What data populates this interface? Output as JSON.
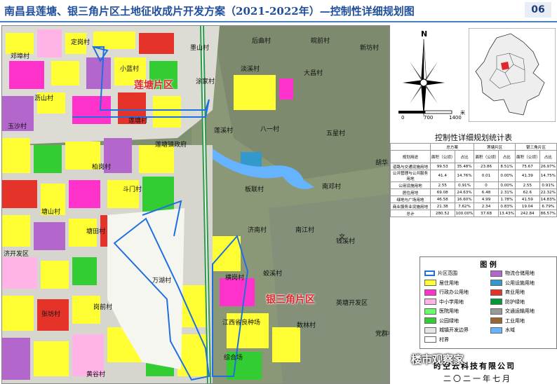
{
  "title": "南昌县莲塘、银三角片区土地征收成片开发方案（2021-2022年）—控制性详细规划图",
  "page_number": "06",
  "map": {
    "zones": [
      "莲塘片区",
      "银三角片区"
    ],
    "places": [
      "定岗村",
      "邓埠村",
      "小蓝村",
      "沥山村",
      "莲塘村",
      "玉沙村",
      "后曲村",
      "皖前村",
      "新坊村",
      "墨山村",
      "淡溪村",
      "涂家村",
      "大昌村",
      "莲溪村",
      "八一村",
      "五星村",
      "胡华",
      "莲塘镇政府",
      "柏岗村",
      "斗门村",
      "板联村",
      "南邓村",
      "塘山村",
      "塘田村",
      "济南村",
      "南江村",
      "钱溪村",
      "济开发区",
      "万湖村",
      "横岗村",
      "蛟溪村",
      "岗前村",
      "张坊村",
      "英塘开发区",
      "江西省良种场",
      "数林村",
      "党群村",
      "综合场",
      "黄谷村",
      "文"
    ]
  },
  "scale": {
    "north": "N",
    "labels": [
      "0",
      "700",
      "1400",
      "米"
    ]
  },
  "stats": {
    "title": "控制性详细规划统计表",
    "group_headers": [
      "总方案",
      "莲塘片区",
      "银三角片区"
    ],
    "col_headers": [
      "规划用途",
      "面积（公顷）",
      "占比",
      "面积（公顷）",
      "占比",
      "面积（公顷）",
      "占比"
    ],
    "rows": [
      [
        "道路与交通设施用地",
        "99.53",
        "35.48%",
        "23.86",
        "8.51%",
        "75.67",
        "26.97%"
      ],
      [
        "公共管理与公共服务用地",
        "41.4",
        "14.76%",
        "0.01",
        "0.00%",
        "41.39",
        "14.75%"
      ],
      [
        "公用设施用地",
        "2.55",
        "0.91%",
        "0",
        "0.00%",
        "2.55",
        "0.91%"
      ],
      [
        "居住用地",
        "69.08",
        "24.63%",
        "6.48",
        "2.31%",
        "62.6",
        "22.32%"
      ],
      [
        "绿地与广场用地",
        "46.58",
        "16.60%",
        "4.99",
        "1.78%",
        "41.59",
        "14.83%"
      ],
      [
        "商业服务业设施用地",
        "21.38",
        "7.62%",
        "2.34",
        "0.83%",
        "19.04",
        "6.79%"
      ],
      [
        "总计",
        "280.52",
        "100.00%",
        "37.68",
        "13.43%",
        "242.84",
        "86.57%"
      ]
    ]
  },
  "legend": {
    "title": "图 例",
    "items": [
      {
        "label": "片区范围",
        "color": "#1f6fe0"
      },
      {
        "label": "居住用地",
        "color": "#ffff33"
      },
      {
        "label": "行政办公用地",
        "color": "#ff33cc"
      },
      {
        "label": "中小学用地",
        "color": "#ffb3e6"
      },
      {
        "label": "医院用地",
        "color": "#66ff66"
      },
      {
        "label": "公园绿地",
        "color": "#33cc33"
      },
      {
        "label": "城镇开发边界",
        "color": "#e6e6e6"
      },
      {
        "label": "村界",
        "color": "#ffffff"
      },
      {
        "label": "物流仓储用地",
        "color": "#b366cc"
      },
      {
        "label": "公用设施用地",
        "color": "#3399cc"
      },
      {
        "label": "商业用地",
        "color": "#e6332a"
      },
      {
        "label": "防护绿地",
        "color": "#009933"
      },
      {
        "label": "交通运输用地",
        "color": "#999999"
      },
      {
        "label": "工业用地",
        "color": "#996633"
      },
      {
        "label": "水域",
        "color": "#66b3ff"
      }
    ]
  },
  "company": "时空云科技有限公司",
  "date": "二〇二一年七月",
  "watermark": "楼市观察家"
}
